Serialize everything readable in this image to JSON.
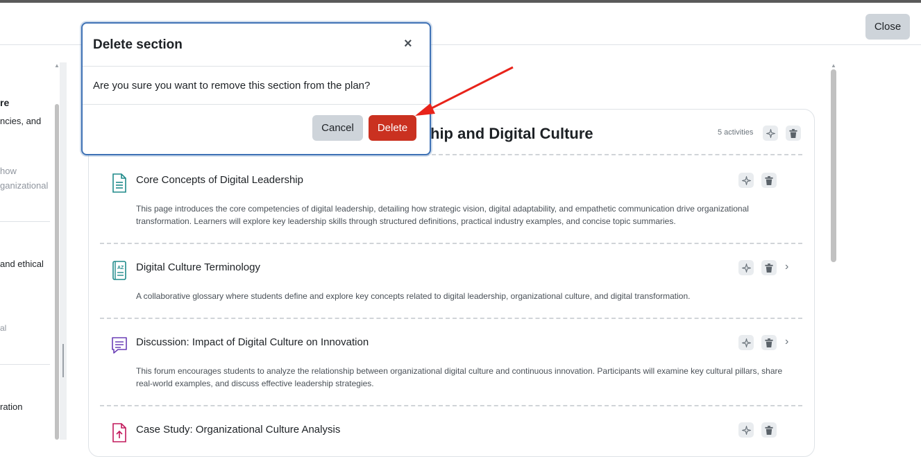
{
  "header": {
    "close_label": "Close"
  },
  "left_panel": {
    "lines": [
      {
        "text": "re",
        "style": "bold"
      },
      {
        "text": "ncies, and",
        "style": "normal"
      },
      {
        "text": "how",
        "style": "muted"
      },
      {
        "text": "ganizational",
        "style": "muted"
      },
      {
        "text": "and ethical",
        "style": "normal"
      },
      {
        "text": "al",
        "style": "muted"
      },
      {
        "text": "ration",
        "style": "normal"
      }
    ]
  },
  "section": {
    "title": "hip and Digital Culture",
    "activity_count": "5 activities"
  },
  "activities": [
    {
      "title": "Core Concepts of Digital Leadership",
      "icon": "page-icon",
      "description": "This page introduces the core competencies of digital leadership, detailing how strategic vision, digital adaptability, and empathetic communication drive organizational transformation. Learners will explore key leadership skills through structured definitions, practical industry examples, and concise topic summaries."
    },
    {
      "title": "Digital Culture Terminology",
      "icon": "glossary-icon",
      "description": "A collaborative glossary where students define and explore key concepts related to digital leadership, organizational culture, and digital transformation."
    },
    {
      "title": "Discussion: Impact of Digital Culture on Innovation",
      "icon": "forum-icon",
      "description": "This forum encourages students to analyze the relationship between organizational digital culture and continuous innovation. Participants will examine key cultural pillars, share real-world examples, and discuss effective leadership strategies."
    },
    {
      "title": "Case Study: Organizational Culture Analysis",
      "icon": "assignment-icon",
      "description": ""
    }
  ],
  "modal": {
    "title": "Delete section",
    "close_symbol": "×",
    "body": "Are you sure you want to remove this section from the plan?",
    "cancel_label": "Cancel",
    "delete_label": "Delete"
  },
  "colors": {
    "delete": "#ca3120",
    "modal_border": "#3f72b5",
    "annotation_arrow": "#e8231a"
  }
}
